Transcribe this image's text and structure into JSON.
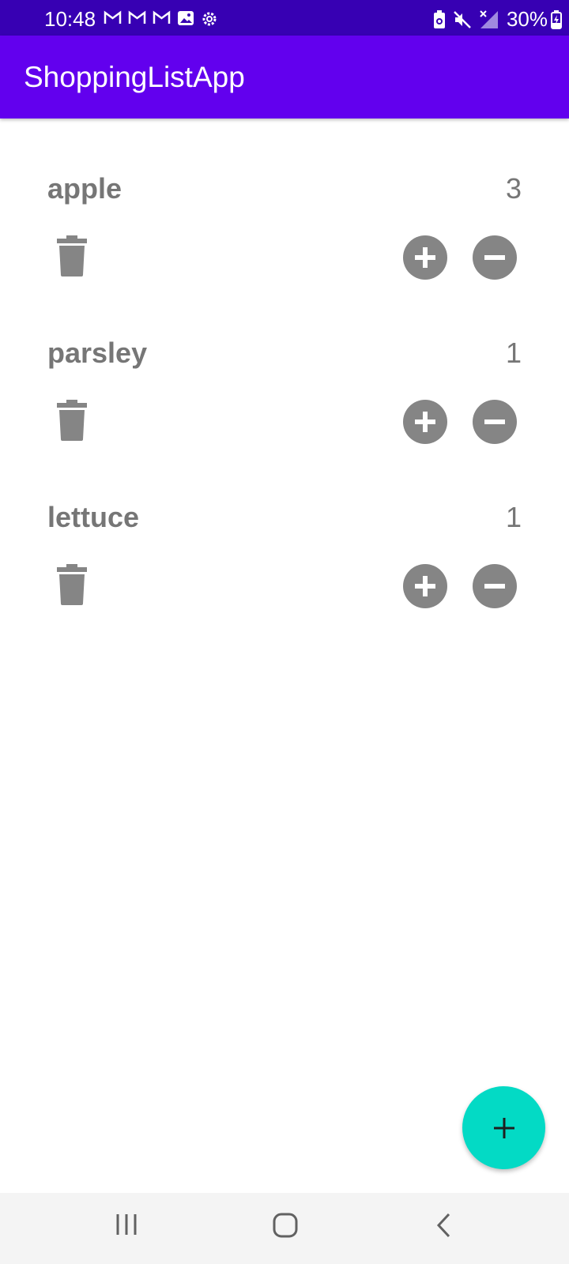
{
  "status_bar": {
    "time": "10:48",
    "battery_percent": "30%",
    "left_icons": [
      "gmail-icon",
      "gmail-icon",
      "gmail-icon",
      "gallery-icon",
      "settings-gear-icon"
    ],
    "right_icons": [
      "battery-saver-icon",
      "mute-icon",
      "no-signal-icon",
      "battery-charging-icon"
    ]
  },
  "app_bar": {
    "title": "ShoppingListApp"
  },
  "items": [
    {
      "name": "apple",
      "quantity": "3"
    },
    {
      "name": "parsley",
      "quantity": "1"
    },
    {
      "name": "lettuce",
      "quantity": "1"
    }
  ],
  "item_actions": [
    "delete-icon",
    "add-circle-icon",
    "remove-circle-icon"
  ],
  "fab": {
    "icon": "plus-icon"
  },
  "nav_bar": {
    "buttons": [
      "recents-icon",
      "home-icon",
      "back-icon"
    ]
  },
  "colors": {
    "status_bar": "#3700b3",
    "app_bar": "#6200ee",
    "fab": "#03dac5",
    "item_text": "#767676",
    "icon_gray": "#858585"
  }
}
